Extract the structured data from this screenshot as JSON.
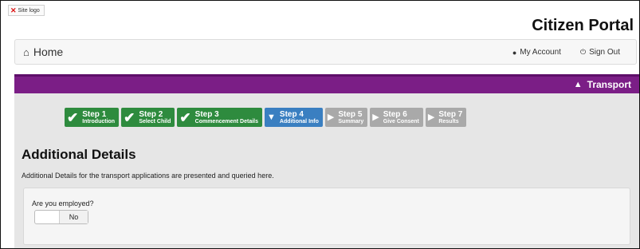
{
  "site_logo": {
    "alt": "Site logo",
    "icon": "broken-image-x"
  },
  "portal_title": "Citizen Portal",
  "nav": {
    "home_icon": "home-icon",
    "home_label": "Home",
    "my_account_label": "My Account",
    "sign_out_label": "Sign Out"
  },
  "section_bar": {
    "label": "Transport",
    "color": "#7b1e86"
  },
  "steps": [
    {
      "title": "Step 1",
      "subtitle": "Introduction",
      "status": "done"
    },
    {
      "title": "Step 2",
      "subtitle": "Select Child",
      "status": "done"
    },
    {
      "title": "Step 3",
      "subtitle": "Commencement Details",
      "status": "done"
    },
    {
      "title": "Step 4",
      "subtitle": "Additional Info",
      "status": "active"
    },
    {
      "title": "Step 5",
      "subtitle": "Summary",
      "status": "todo"
    },
    {
      "title": "Step 6",
      "subtitle": "Give Consent",
      "status": "todo"
    },
    {
      "title": "Step 7",
      "subtitle": "Results",
      "status": "todo"
    }
  ],
  "page": {
    "heading": "Additional Details",
    "description": "Additional Details for the transport applications are presented and queried here."
  },
  "form": {
    "employed_question": "Are you employed?",
    "employed_option_no": "No"
  }
}
